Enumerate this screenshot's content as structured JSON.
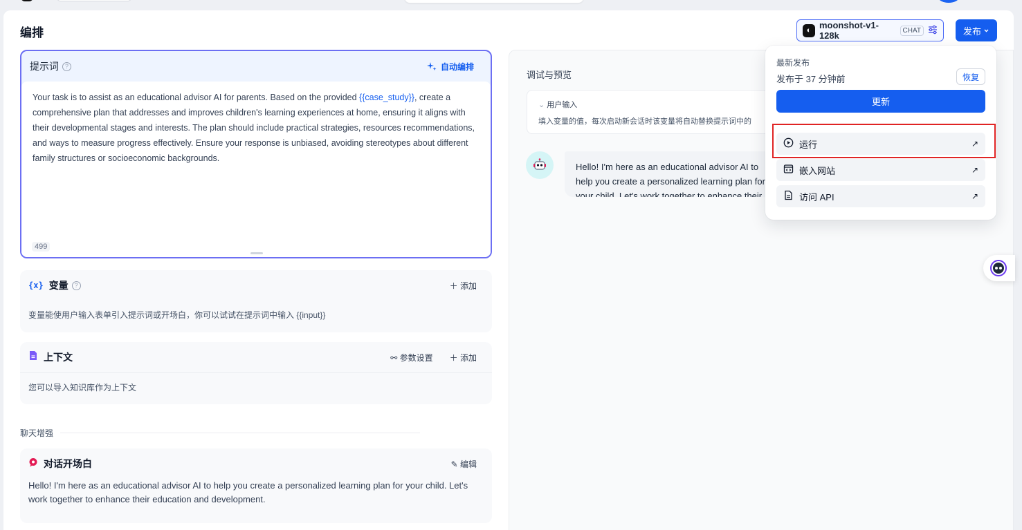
{
  "header": {
    "title": "编排",
    "model": {
      "name": "moonshot-v1-128k",
      "badge": "CHAT"
    },
    "publish_label": "发布"
  },
  "prompt": {
    "title": "提示词",
    "auto_label": "自动编排",
    "text_before": "Your task is to assist as an educational advisor AI for parents. Based on the provided ",
    "variable": "{{case_study}}",
    "text_after": ", create a comprehensive plan that addresses and improves children's learning experiences at home, ensuring it aligns with their developmental stages and interests. The plan should include practical strategies, resources recommendations, and ways to measure progress effectively. Ensure your response is unbiased, avoiding stereotypes about different family structures or socioeconomic backgrounds.",
    "char_count": "499"
  },
  "variables": {
    "title": "变量",
    "add_label": "添加",
    "description": "变量能使用户输入表单引入提示词或开场白，你可以试试在提示词中输入 {{input}}"
  },
  "context": {
    "title": "上下文",
    "settings_label": "参数设置",
    "add_label": "添加",
    "description": "您可以导入知识库作为上下文"
  },
  "chat_enhance": {
    "label": "聊天增强"
  },
  "opening": {
    "title": "对话开场白",
    "edit_label": "编辑",
    "text": "Hello! I'm here as an educational advisor AI to help you create a personalized learning plan for your child. Let's work together to enhance their education and development."
  },
  "debug": {
    "title": "调试与预览",
    "user_input_label": "用户输入",
    "user_input_desc": "填入变量的值，每次启动新会话时该变量将自动替换提示词中的",
    "bot_message": "Hello! I'm here as an educational advisor AI to help you create a personalized learning plan for your child. Let's work together to enhance their education and development."
  },
  "publish_menu": {
    "latest_label": "最新发布",
    "published_time": "发布于 37 分钟前",
    "restore_label": "恢复",
    "update_label": "更新",
    "items": [
      {
        "label": "运行",
        "icon": "play-circle-icon"
      },
      {
        "label": "嵌入网站",
        "icon": "embed-icon"
      },
      {
        "label": "访问 API",
        "icon": "document-icon"
      }
    ]
  },
  "colors": {
    "primary": "#155eef",
    "highlight": "#e02424",
    "prompt_border": "#6c6ff3"
  }
}
